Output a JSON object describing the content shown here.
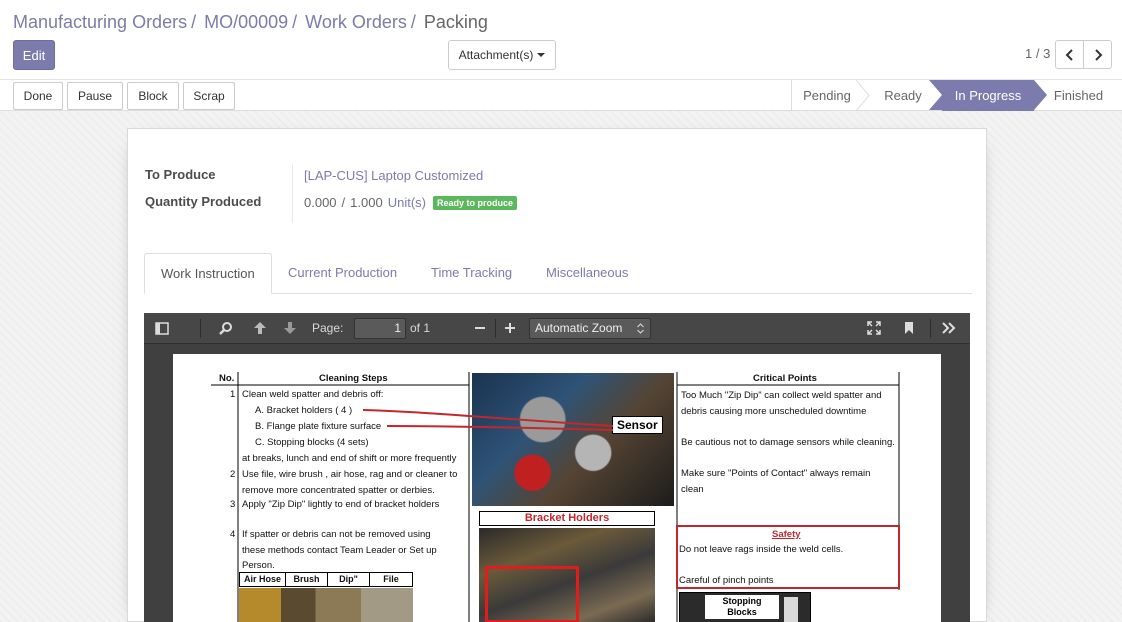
{
  "breadcrumb": {
    "item1": "Manufacturing Orders",
    "item2": "MO/00009",
    "item3": "Work Orders",
    "current": "Packing",
    "sep": "/"
  },
  "toolbar": {
    "edit_label": "Edit",
    "attachments_label": "Attachment(s)",
    "pager": "1 / 3"
  },
  "statusbar": {
    "buttons": [
      "Done",
      "Pause",
      "Block",
      "Scrap"
    ],
    "stages": [
      "Pending",
      "Ready",
      "In Progress",
      "Finished"
    ],
    "active_stage": "In Progress"
  },
  "form": {
    "to_produce_label": "To Produce",
    "to_produce_value": "[LAP-CUS] Laptop Customized",
    "qty_label": "Quantity Produced",
    "qty_done": "0.000",
    "qty_sep": "/",
    "qty_total": "1.000",
    "uom": "Unit(s)",
    "status_badge": "Ready to produce"
  },
  "tabs": [
    "Work Instruction",
    "Current Production",
    "Time Tracking",
    "Miscellaneous"
  ],
  "pdf": {
    "page_label": "Page:",
    "page_value": "1",
    "page_total": "of 1",
    "zoom": "Automatic Zoom",
    "doc": {
      "col_no": "No.",
      "col_steps": "Cleaning Steps",
      "col_critical": "Critical Points",
      "step1_no": "1",
      "step1": "Clean weld spatter and debris off:",
      "step1a": "A. Bracket holders ( 4 )",
      "step1b": "B. Flange plate fixture surface",
      "step1c": "C. Stopping blocks (4 sets)",
      "step1d": "at breaks, lunch and end of shift or more frequently",
      "step2_no": "2",
      "step2a": "Use file, wire brush , air hose, rag and or cleaner to",
      "step2b": "remove more concentrated spatter or derbies.",
      "step3_no": "3",
      "step3": "Apply \"Zip Dip\" lightly to end of bracket holders",
      "step4_no": "4",
      "step4a": "If spatter or debris can not be removed using",
      "step4b": "these methods contact Team Leader or Set up",
      "step4c": "Person.",
      "tool_labels": [
        "Air Hose",
        "Brush",
        "Dip\"",
        "File"
      ],
      "sensor_label": "Sensor",
      "bracket_label": "Bracket Holders",
      "stopping_label1": "Stopping",
      "stopping_label2": "Blocks",
      "crit1a": "Too Much \"Zip Dip\" can collect weld spatter and",
      "crit1b": "debris causing more unscheduled downtime",
      "crit2": "Be cautious not to damage sensors while cleaning.",
      "crit3a": "Make sure \"Points of Contact\" always remain",
      "crit3b": "clean",
      "safety_title": "Safety",
      "safety1": "Do not leave rags inside the weld cells.",
      "safety2": "Careful of pinch points"
    }
  },
  "colors": {
    "brand": "#7c7bad",
    "badge": "#5cb85c",
    "pdf_toolbar": "#474747"
  }
}
